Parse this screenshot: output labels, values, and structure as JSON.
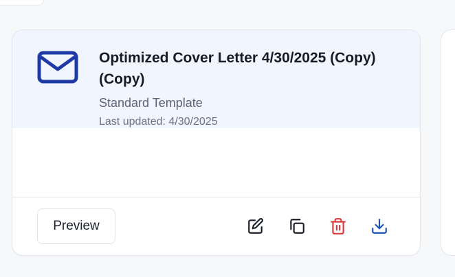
{
  "card": {
    "title": "Optimized Cover Letter 4/30/2025 (Copy) (Copy)",
    "template": "Standard Template",
    "last_updated": "Last updated: 4/30/2025",
    "icon": "mail-icon"
  },
  "actions": {
    "preview_label": "Preview",
    "edit_icon": "edit-icon",
    "copy_icon": "copy-icon",
    "delete_icon": "trash-icon",
    "download_icon": "download-icon"
  },
  "colors": {
    "header_bg": "#f0f5ff",
    "mail_icon": "#1f3aa6",
    "title": "#161b26",
    "subtitle": "#5b6474",
    "delete": "#dc3b3b",
    "download": "#1d4fb0",
    "neutral_icon": "#1b1f2a"
  }
}
